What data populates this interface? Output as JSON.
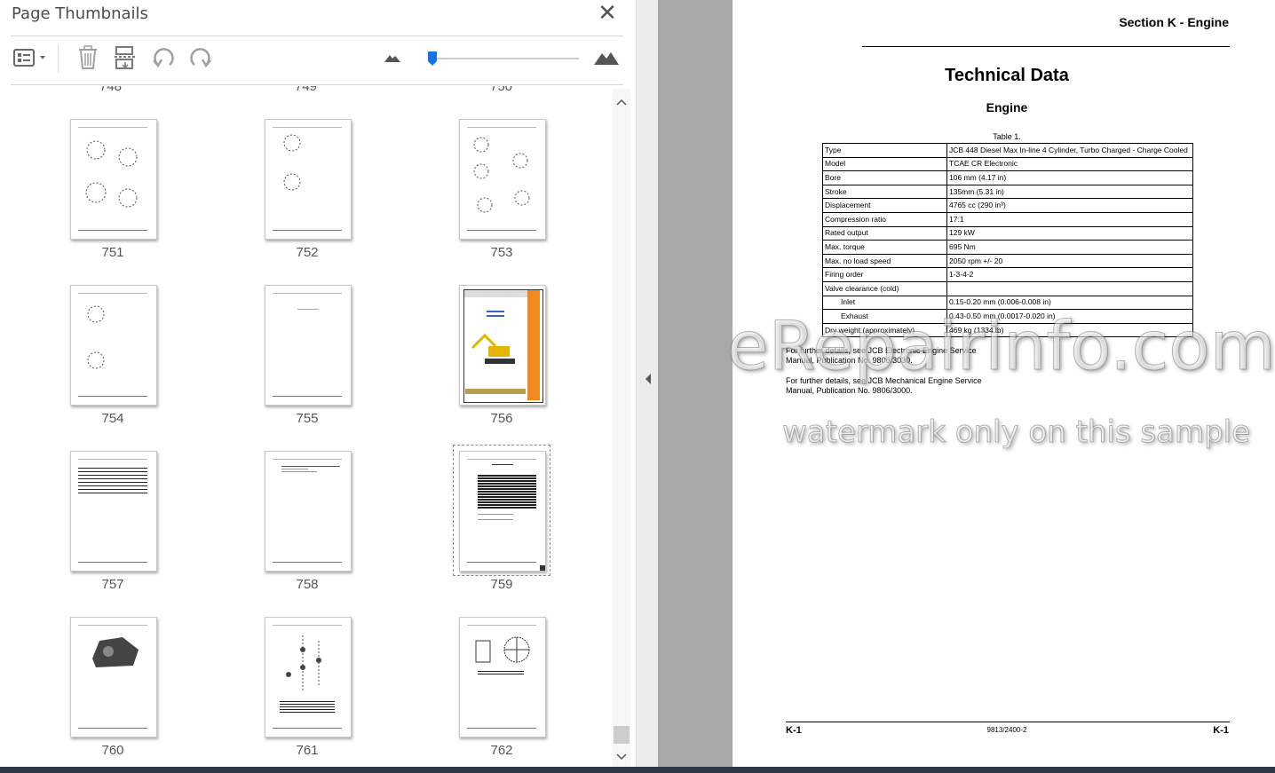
{
  "panel": {
    "title": "Page Thumbnails",
    "close_glyph": "✕",
    "toolbar": {
      "options_icon": "options-menu-icon",
      "delete_icon": "trash-icon",
      "extract_icon": "extract-pages-icon",
      "rotate_ccw_icon": "rotate-counterclockwise-icon",
      "rotate_cw_icon": "rotate-clockwise-icon",
      "zoom_out_icon": "small-mountain-icon",
      "zoom_in_icon": "large-mountain-icon",
      "zoom_level": 0.02
    },
    "thumbnails": [
      {
        "label": "751",
        "kind": "gears"
      },
      {
        "label": "752",
        "kind": "gears-sparse"
      },
      {
        "label": "753",
        "kind": "gears-dense"
      },
      {
        "label": "754",
        "kind": "gears-small"
      },
      {
        "label": "755",
        "kind": "blank-text"
      },
      {
        "label": "756",
        "kind": "cover"
      },
      {
        "label": "757",
        "kind": "lined"
      },
      {
        "label": "758",
        "kind": "short-list"
      },
      {
        "label": "759",
        "kind": "table",
        "selected": true
      },
      {
        "label": "760",
        "kind": "engine"
      },
      {
        "label": "761",
        "kind": "exploded"
      },
      {
        "label": "762",
        "kind": "fan"
      }
    ]
  },
  "document": {
    "section_header": "Section K - Engine",
    "title": "Technical Data",
    "subtitle": "Engine",
    "table_caption": "Table 1.",
    "table_rows": [
      {
        "label": "Type",
        "value": "JCB 448 Diesel Max In-line 4 Cylinder, Turbo Charged - Charge Cooled"
      },
      {
        "label": "Model",
        "value": "TCAE CR Electronic"
      },
      {
        "label": "Bore",
        "value": "106 mm (4.17 in)"
      },
      {
        "label": "Stroke",
        "value": "135mm (5.31 in)"
      },
      {
        "label": "Displacement",
        "value": "4765 cc (290 in³)"
      },
      {
        "label": "Compression ratio",
        "value": "17:1"
      },
      {
        "label": "Rated output",
        "value": "129 kW"
      },
      {
        "label": "Max. torque",
        "value": "695 Nm"
      },
      {
        "label": "Max. no load speed",
        "value": "2050 rpm +/- 20"
      },
      {
        "label": "Firing order",
        "value": "1-3-4-2"
      },
      {
        "label": "Valve clearance (cold)",
        "value": ""
      },
      {
        "label": "Inlet",
        "value": "0.15-0.20 mm (0.006-0.008 in)",
        "indent": true
      },
      {
        "label": "Exhaust",
        "value": "0.43-0.50 mm (0.0017-0.020 in)",
        "indent": true
      },
      {
        "label": "Dry weight (approximately)",
        "value": "469 kg (1334 lb)"
      }
    ],
    "note1_line1": "For further details, see JCB Electronic Engine Service",
    "note1_line2": "Manual, Publication No. 9806/3030.",
    "note2_line1": "For further details, see JCB Mechanical Engine Service",
    "note2_line2": "Manual, Publication No. 9806/3000.",
    "footer_left": "K-1",
    "footer_center": "9813/2400-2",
    "footer_right": "K-1",
    "watermark_main": "eRepairinfo.com",
    "watermark_sub": "watermark only on this sample"
  },
  "colors": {
    "slider_accent": "#1473e6",
    "gutter": "#a8a8a8",
    "cover_orange": "#f08a1e",
    "taskbar": "#2b3a45"
  }
}
